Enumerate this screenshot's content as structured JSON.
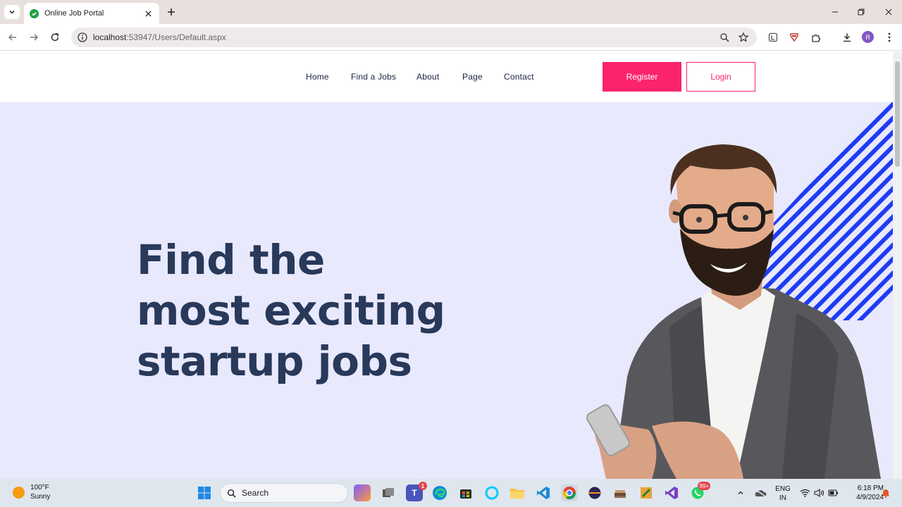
{
  "browser": {
    "tab_title": "Online Job Portal",
    "url_host": "localhost",
    "url_rest": ":53947/Users/Default.aspx",
    "profile_initial": "R"
  },
  "site": {
    "nav": [
      "Home",
      "Find a Jobs",
      "About",
      "Page",
      "Contact"
    ],
    "register_label": "Register",
    "login_label": "Login",
    "hero_lines": [
      "Find the",
      "most exciting",
      "startup jobs"
    ],
    "colors": {
      "accent": "#fb246a",
      "hero_bg": "#e9e9fd",
      "heading": "#28395a",
      "stripes": "#1f3cf5"
    }
  },
  "taskbar": {
    "weather_temp": "100°F",
    "weather_desc": "Sunny",
    "search_label": "Search",
    "teams_badge": "1",
    "whatsapp_badge": "99+",
    "lang_line1": "ENG",
    "lang_line2": "IN",
    "time": "6:18 PM",
    "date": "4/9/2024"
  }
}
